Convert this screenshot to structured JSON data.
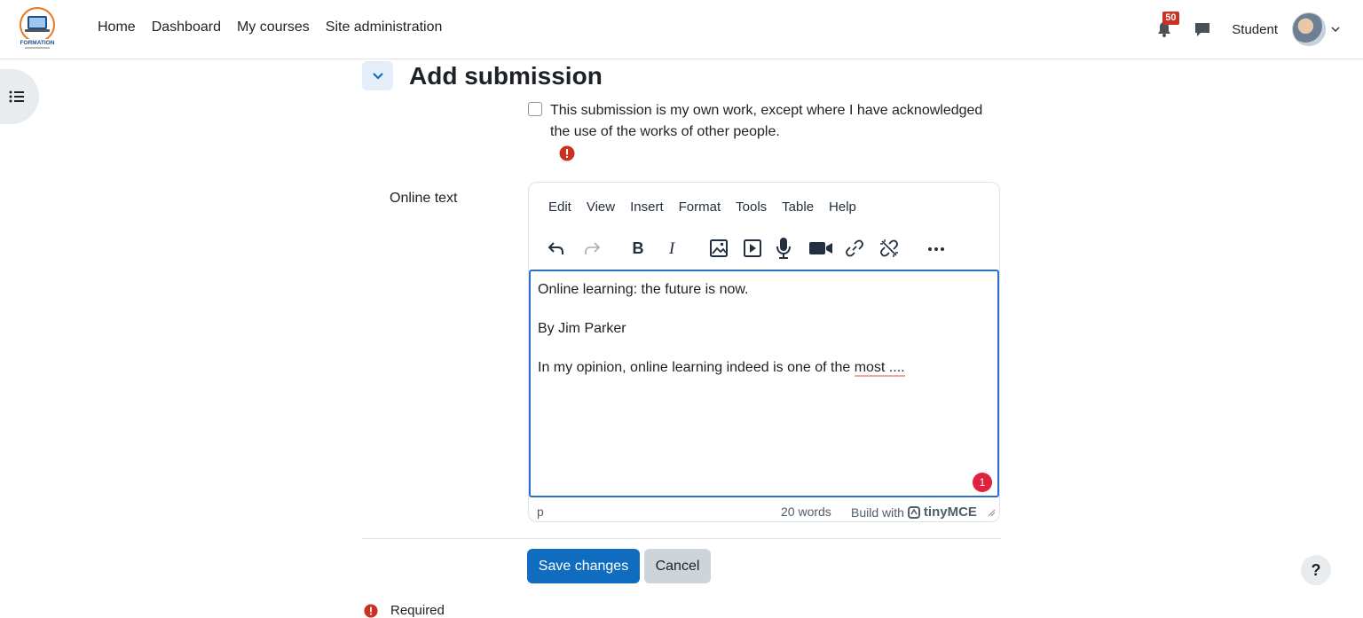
{
  "nav": {
    "links": [
      "Home",
      "Dashboard",
      "My courses",
      "Site administration"
    ],
    "notification_count": "50",
    "user_name": "Student"
  },
  "section": {
    "title": "Add submission"
  },
  "acknowledgement": {
    "text": "This submission is my own work, except where I have acknowledged the use of the works of other people."
  },
  "online_text": {
    "label": "Online text"
  },
  "editor": {
    "menu": [
      "Edit",
      "View",
      "Insert",
      "Format",
      "Tools",
      "Table",
      "Help"
    ],
    "content": {
      "line1": "Online learning: the future is now.",
      "line2": "By Jim Parker",
      "line3_prefix": "In my opinion, online learning indeed is one of the ",
      "line3_spell": "most ....",
      "badge": "1"
    },
    "status": {
      "path": "p",
      "word_count": "20 words",
      "branding": "Build with",
      "brand_name": "tinyMCE"
    }
  },
  "form": {
    "save_label": "Save changes",
    "cancel_label": "Cancel",
    "required_label": "Required",
    "help_label": "?"
  },
  "colors": {
    "primary": "#0f6cbf",
    "error": "#ca3120"
  }
}
